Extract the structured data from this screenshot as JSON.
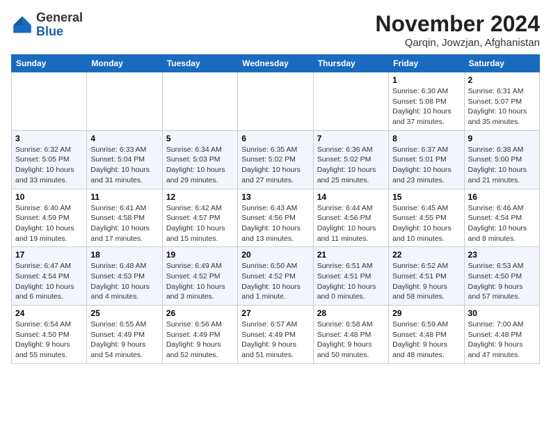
{
  "logo": {
    "general": "General",
    "blue": "Blue"
  },
  "title": "November 2024",
  "location": "Qarqin, Jowzjan, Afghanistan",
  "weekdays": [
    "Sunday",
    "Monday",
    "Tuesday",
    "Wednesday",
    "Thursday",
    "Friday",
    "Saturday"
  ],
  "weeks": [
    [
      {
        "day": "",
        "info": ""
      },
      {
        "day": "",
        "info": ""
      },
      {
        "day": "",
        "info": ""
      },
      {
        "day": "",
        "info": ""
      },
      {
        "day": "",
        "info": ""
      },
      {
        "day": "1",
        "info": "Sunrise: 6:30 AM\nSunset: 5:08 PM\nDaylight: 10 hours and 37 minutes."
      },
      {
        "day": "2",
        "info": "Sunrise: 6:31 AM\nSunset: 5:07 PM\nDaylight: 10 hours and 35 minutes."
      }
    ],
    [
      {
        "day": "3",
        "info": "Sunrise: 6:32 AM\nSunset: 5:05 PM\nDaylight: 10 hours and 33 minutes."
      },
      {
        "day": "4",
        "info": "Sunrise: 6:33 AM\nSunset: 5:04 PM\nDaylight: 10 hours and 31 minutes."
      },
      {
        "day": "5",
        "info": "Sunrise: 6:34 AM\nSunset: 5:03 PM\nDaylight: 10 hours and 29 minutes."
      },
      {
        "day": "6",
        "info": "Sunrise: 6:35 AM\nSunset: 5:02 PM\nDaylight: 10 hours and 27 minutes."
      },
      {
        "day": "7",
        "info": "Sunrise: 6:36 AM\nSunset: 5:02 PM\nDaylight: 10 hours and 25 minutes."
      },
      {
        "day": "8",
        "info": "Sunrise: 6:37 AM\nSunset: 5:01 PM\nDaylight: 10 hours and 23 minutes."
      },
      {
        "day": "9",
        "info": "Sunrise: 6:38 AM\nSunset: 5:00 PM\nDaylight: 10 hours and 21 minutes."
      }
    ],
    [
      {
        "day": "10",
        "info": "Sunrise: 6:40 AM\nSunset: 4:59 PM\nDaylight: 10 hours and 19 minutes."
      },
      {
        "day": "11",
        "info": "Sunrise: 6:41 AM\nSunset: 4:58 PM\nDaylight: 10 hours and 17 minutes."
      },
      {
        "day": "12",
        "info": "Sunrise: 6:42 AM\nSunset: 4:57 PM\nDaylight: 10 hours and 15 minutes."
      },
      {
        "day": "13",
        "info": "Sunrise: 6:43 AM\nSunset: 4:56 PM\nDaylight: 10 hours and 13 minutes."
      },
      {
        "day": "14",
        "info": "Sunrise: 6:44 AM\nSunset: 4:56 PM\nDaylight: 10 hours and 11 minutes."
      },
      {
        "day": "15",
        "info": "Sunrise: 6:45 AM\nSunset: 4:55 PM\nDaylight: 10 hours and 10 minutes."
      },
      {
        "day": "16",
        "info": "Sunrise: 6:46 AM\nSunset: 4:54 PM\nDaylight: 10 hours and 8 minutes."
      }
    ],
    [
      {
        "day": "17",
        "info": "Sunrise: 6:47 AM\nSunset: 4:54 PM\nDaylight: 10 hours and 6 minutes."
      },
      {
        "day": "18",
        "info": "Sunrise: 6:48 AM\nSunset: 4:53 PM\nDaylight: 10 hours and 4 minutes."
      },
      {
        "day": "19",
        "info": "Sunrise: 6:49 AM\nSunset: 4:52 PM\nDaylight: 10 hours and 3 minutes."
      },
      {
        "day": "20",
        "info": "Sunrise: 6:50 AM\nSunset: 4:52 PM\nDaylight: 10 hours and 1 minute."
      },
      {
        "day": "21",
        "info": "Sunrise: 6:51 AM\nSunset: 4:51 PM\nDaylight: 10 hours and 0 minutes."
      },
      {
        "day": "22",
        "info": "Sunrise: 6:52 AM\nSunset: 4:51 PM\nDaylight: 9 hours and 58 minutes."
      },
      {
        "day": "23",
        "info": "Sunrise: 6:53 AM\nSunset: 4:50 PM\nDaylight: 9 hours and 57 minutes."
      }
    ],
    [
      {
        "day": "24",
        "info": "Sunrise: 6:54 AM\nSunset: 4:50 PM\nDaylight: 9 hours and 55 minutes."
      },
      {
        "day": "25",
        "info": "Sunrise: 6:55 AM\nSunset: 4:49 PM\nDaylight: 9 hours and 54 minutes."
      },
      {
        "day": "26",
        "info": "Sunrise: 6:56 AM\nSunset: 4:49 PM\nDaylight: 9 hours and 52 minutes."
      },
      {
        "day": "27",
        "info": "Sunrise: 6:57 AM\nSunset: 4:49 PM\nDaylight: 9 hours and 51 minutes."
      },
      {
        "day": "28",
        "info": "Sunrise: 6:58 AM\nSunset: 4:48 PM\nDaylight: 9 hours and 50 minutes."
      },
      {
        "day": "29",
        "info": "Sunrise: 6:59 AM\nSunset: 4:48 PM\nDaylight: 9 hours and 48 minutes."
      },
      {
        "day": "30",
        "info": "Sunrise: 7:00 AM\nSunset: 4:48 PM\nDaylight: 9 hours and 47 minutes."
      }
    ]
  ]
}
